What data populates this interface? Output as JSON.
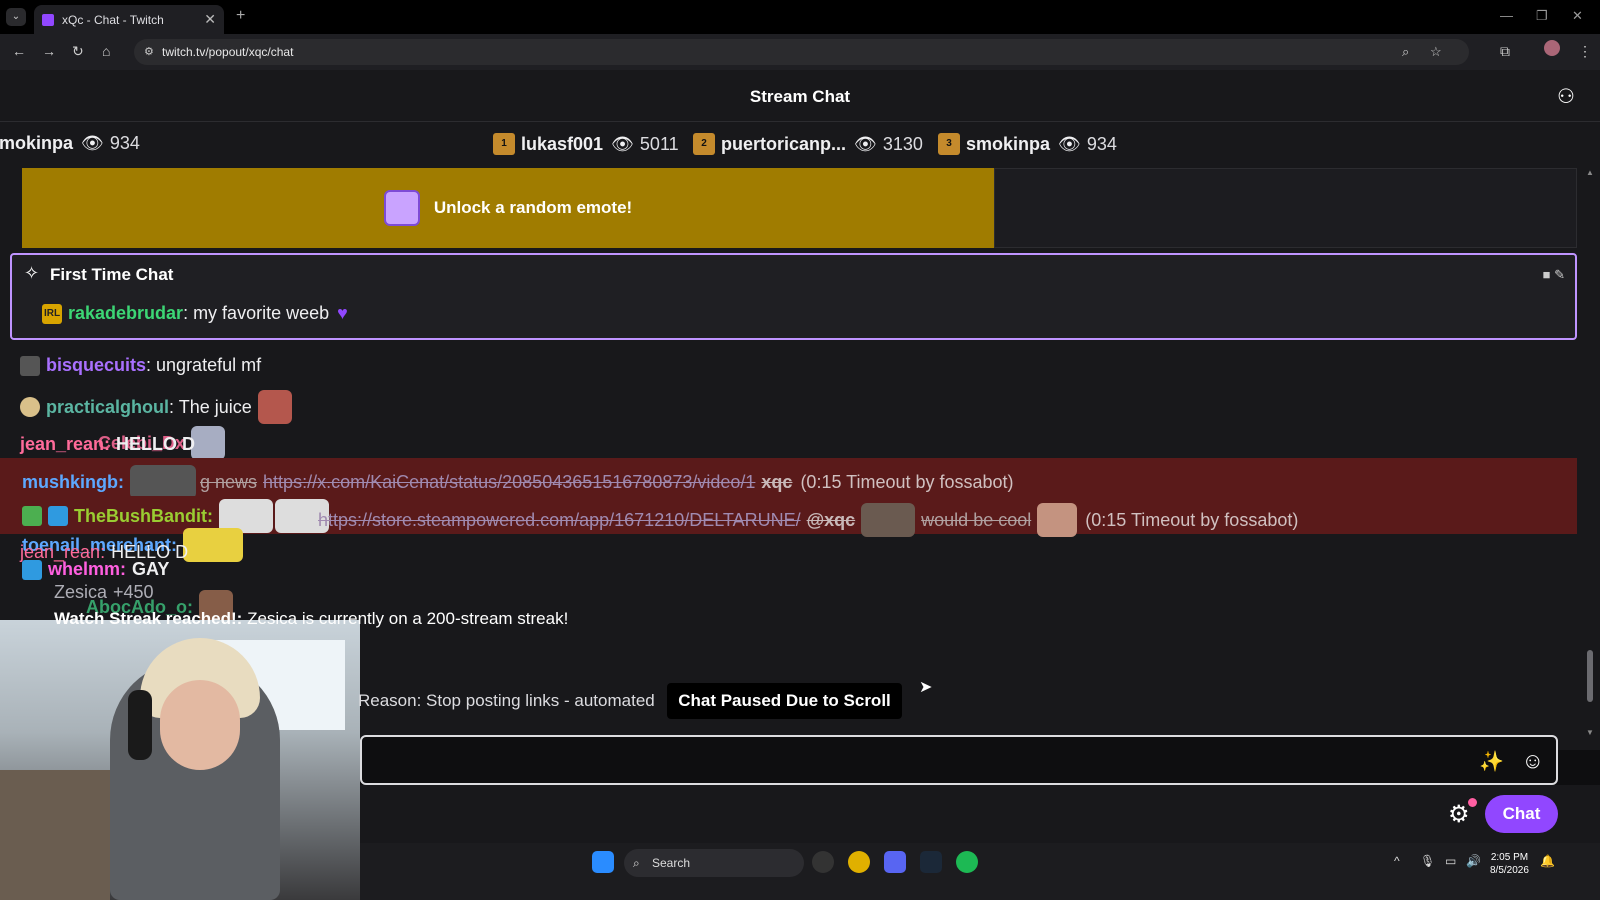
{
  "browser": {
    "tab_title": "xQc - Chat - Twitch",
    "url": "twitch.tv/popout/xqc/chat"
  },
  "header": {
    "title": "Stream Chat"
  },
  "leaderboard": [
    {
      "name": "mokinpa",
      "count": "934",
      "rank": ""
    },
    {
      "name": "lukasf001",
      "count": "5011",
      "rank": "1"
    },
    {
      "name": "puertoricanp...",
      "count": "3130",
      "rank": "2"
    },
    {
      "name": "smokinpa",
      "count": "934",
      "rank": "3"
    }
  ],
  "unlock": {
    "label": "Unlock a random emote!"
  },
  "first_time_chat": {
    "title": "First Time Chat",
    "badge": "IRL",
    "user": "rakadebrudar",
    "message": ": my favorite weeb"
  },
  "messages": [
    {
      "user": "bisquecuits",
      "text": ": ungrateful mf",
      "color": "#a970ff"
    },
    {
      "user": "practicalghoul",
      "text": ": The juice",
      "color": "#5bb5a2"
    }
  ],
  "overlapping": {
    "celebi": "Celebi_Dx",
    "jean1": "jean_rean:",
    "jean1_text": "HELLO D",
    "mushking": "mushkingb:",
    "news_prefix": "g news",
    "link1": "https://x.com/KaiCenat/status/2085043651516780873/video/1",
    "xqc": "xqc",
    "timeout1": "(0:15 Timeout by fossabot)",
    "bushbandit": "TheBushBandit:",
    "link2": "https://store.steampowered.com/app/1671210/DELTARUNE/",
    "at_xqc": "@xqc",
    "cool": "would be cool",
    "timeout2": "(0:15 Timeout by fossabot)",
    "toenail": "toenail_merchant:",
    "jean2": "jean_rean:",
    "jean2_text": "HELLO D",
    "whelmm": "whelmm:",
    "whelmm_text": "GAY",
    "zesica": "Zesica",
    "zesica_pts": "+450",
    "abocado": "AbocAdo_o:"
  },
  "streak": {
    "label": "Watch Streak reached!:",
    "text": "Zesica is currently on a 200-stream streak!"
  },
  "reason": "Reason: Stop posting links - automated",
  "paused": "Chat Paused Due to Scroll",
  "input": {
    "placeholder": ""
  },
  "chat_button": "Chat",
  "taskbar": {
    "search": "Search",
    "time": "2:05 PM",
    "date": "8/5/2026"
  },
  "colors": {
    "accent": "#9147ff",
    "banner": "#a07c00",
    "timeout_bg": "#5a1a1a"
  }
}
